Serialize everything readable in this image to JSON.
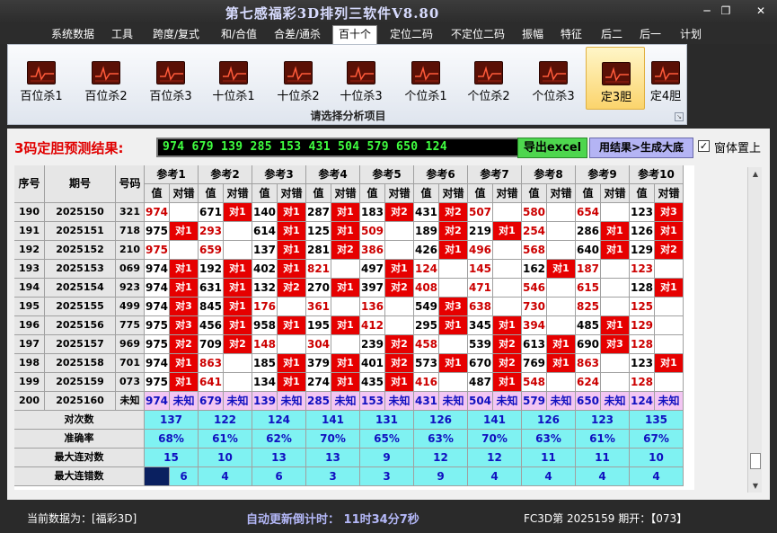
{
  "window": {
    "title": "第七感福彩3D排列三软件V8.80",
    "minimize_glyph": "─",
    "restore_glyph": "❐",
    "close_glyph": "✕"
  },
  "menu": {
    "items": [
      "系统数据",
      "工具",
      "跨度/复式",
      "和/合值",
      "合差/通杀",
      "百十个",
      "定位二码",
      "不定位二码",
      "振幅",
      "特征",
      "后二",
      "后一",
      "计划"
    ],
    "active": "百十个"
  },
  "ribbon": {
    "buttons": [
      {
        "label": "百位杀1",
        "icon": "chart-icon"
      },
      {
        "label": "百位杀2",
        "icon": "chart-icon"
      },
      {
        "label": "百位杀3",
        "icon": "chart-icon"
      },
      {
        "label": "十位杀1",
        "icon": "chart-icon"
      },
      {
        "label": "十位杀2",
        "icon": "chart-icon"
      },
      {
        "label": "十位杀3",
        "icon": "chart-icon"
      },
      {
        "label": "个位杀1",
        "icon": "chart-icon"
      },
      {
        "label": "个位杀2",
        "icon": "chart-icon"
      },
      {
        "label": "个位杀3",
        "icon": "chart-icon"
      },
      {
        "label": "定3胆",
        "icon": "chart-icon"
      },
      {
        "label": "定4胆",
        "icon": "chart-icon"
      }
    ],
    "active": "定3胆",
    "group_label": "请选择分析项目",
    "launcher_glyph": "↘"
  },
  "result": {
    "label": "3码定胆预测结果:",
    "value": "974 679 139 285 153 431 504 579 650 124",
    "export_button": "导出excel",
    "bigbase_button": "用结果>生成大底",
    "stay_on_top_label": "窗体置上",
    "stay_on_top_checked": true
  },
  "table": {
    "headers": {
      "seq": "序号",
      "period": "期号",
      "number": "号码",
      "value": "值",
      "result": "对错"
    },
    "ref_headers": [
      "参考1",
      "参考2",
      "参考3",
      "参考4",
      "参考5",
      "参考6",
      "参考7",
      "参考8",
      "参考9",
      "参考10"
    ],
    "rows": [
      {
        "seq": "190",
        "period": "2025150",
        "number": "321",
        "cells": [
          [
            "974",
            ""
          ],
          [
            "671",
            "对1"
          ],
          [
            "140",
            "对1"
          ],
          [
            "287",
            "对1"
          ],
          [
            "183",
            "对2"
          ],
          [
            "431",
            "对2"
          ],
          [
            "507",
            ""
          ],
          [
            "580",
            ""
          ],
          [
            "654",
            ""
          ],
          [
            "123",
            "对3"
          ]
        ]
      },
      {
        "seq": "191",
        "period": "2025151",
        "number": "718",
        "cells": [
          [
            "975",
            "对1"
          ],
          [
            "293",
            ""
          ],
          [
            "614",
            "对1"
          ],
          [
            "125",
            "对1"
          ],
          [
            "509",
            ""
          ],
          [
            "189",
            "对2"
          ],
          [
            "219",
            "对1"
          ],
          [
            "254",
            ""
          ],
          [
            "286",
            "对1"
          ],
          [
            "126",
            "对1"
          ]
        ]
      },
      {
        "seq": "192",
        "period": "2025152",
        "number": "210",
        "cells": [
          [
            "975",
            ""
          ],
          [
            "659",
            ""
          ],
          [
            "137",
            "对1"
          ],
          [
            "281",
            "对2"
          ],
          [
            "386",
            ""
          ],
          [
            "426",
            "对1"
          ],
          [
            "496",
            ""
          ],
          [
            "568",
            ""
          ],
          [
            "640",
            "对1"
          ],
          [
            "129",
            "对2"
          ]
        ]
      },
      {
        "seq": "193",
        "period": "2025153",
        "number": "069",
        "cells": [
          [
            "974",
            "对1"
          ],
          [
            "192",
            "对1"
          ],
          [
            "402",
            "对1"
          ],
          [
            "821",
            ""
          ],
          [
            "497",
            "对1"
          ],
          [
            "124",
            ""
          ],
          [
            "145",
            ""
          ],
          [
            "162",
            "对1"
          ],
          [
            "187",
            ""
          ],
          [
            "123",
            ""
          ]
        ]
      },
      {
        "seq": "194",
        "period": "2025154",
        "number": "923",
        "cells": [
          [
            "974",
            "对1"
          ],
          [
            "631",
            "对1"
          ],
          [
            "132",
            "对2"
          ],
          [
            "270",
            "对1"
          ],
          [
            "397",
            "对2"
          ],
          [
            "408",
            ""
          ],
          [
            "471",
            ""
          ],
          [
            "546",
            ""
          ],
          [
            "615",
            ""
          ],
          [
            "128",
            "对1"
          ]
        ]
      },
      {
        "seq": "195",
        "period": "2025155",
        "number": "499",
        "cells": [
          [
            "974",
            "对3"
          ],
          [
            "845",
            "对1"
          ],
          [
            "176",
            ""
          ],
          [
            "361",
            ""
          ],
          [
            "136",
            ""
          ],
          [
            "549",
            "对3"
          ],
          [
            "638",
            ""
          ],
          [
            "730",
            ""
          ],
          [
            "825",
            ""
          ],
          [
            "125",
            ""
          ]
        ]
      },
      {
        "seq": "196",
        "period": "2025156",
        "number": "775",
        "cells": [
          [
            "975",
            "对3"
          ],
          [
            "456",
            "对1"
          ],
          [
            "958",
            "对1"
          ],
          [
            "195",
            "对1"
          ],
          [
            "412",
            ""
          ],
          [
            "295",
            "对1"
          ],
          [
            "345",
            "对1"
          ],
          [
            "394",
            ""
          ],
          [
            "485",
            "对1"
          ],
          [
            "129",
            ""
          ]
        ]
      },
      {
        "seq": "197",
        "period": "2025157",
        "number": "969",
        "cells": [
          [
            "975",
            "对2"
          ],
          [
            "709",
            "对2"
          ],
          [
            "148",
            ""
          ],
          [
            "304",
            ""
          ],
          [
            "239",
            "对2"
          ],
          [
            "458",
            ""
          ],
          [
            "539",
            "对2"
          ],
          [
            "613",
            "对1"
          ],
          [
            "690",
            "对3"
          ],
          [
            "128",
            ""
          ]
        ]
      },
      {
        "seq": "198",
        "period": "2025158",
        "number": "701",
        "cells": [
          [
            "974",
            "对1"
          ],
          [
            "863",
            ""
          ],
          [
            "185",
            "对1"
          ],
          [
            "379",
            "对1"
          ],
          [
            "401",
            "对2"
          ],
          [
            "573",
            "对1"
          ],
          [
            "670",
            "对2"
          ],
          [
            "769",
            "对1"
          ],
          [
            "863",
            ""
          ],
          [
            "123",
            "对1"
          ]
        ]
      },
      {
        "seq": "199",
        "period": "2025159",
        "number": "073",
        "cells": [
          [
            "975",
            "对1"
          ],
          [
            "641",
            ""
          ],
          [
            "134",
            "对1"
          ],
          [
            "274",
            "对1"
          ],
          [
            "435",
            "对1"
          ],
          [
            "416",
            ""
          ],
          [
            "487",
            "对1"
          ],
          [
            "548",
            ""
          ],
          [
            "624",
            ""
          ],
          [
            "128",
            ""
          ]
        ]
      }
    ],
    "prediction_row": {
      "seq": "200",
      "period": "2025160",
      "number": "未知",
      "values": [
        "974",
        "679",
        "139",
        "285",
        "153",
        "431",
        "504",
        "579",
        "650",
        "124"
      ],
      "result": "未知"
    },
    "stats": [
      {
        "label": "对次数",
        "values": [
          "137",
          "122",
          "124",
          "141",
          "131",
          "126",
          "141",
          "126",
          "123",
          "135"
        ]
      },
      {
        "label": "准确率",
        "values": [
          "68%",
          "61%",
          "62%",
          "70%",
          "65%",
          "63%",
          "70%",
          "63%",
          "61%",
          "67%"
        ]
      },
      {
        "label": "最大连对数",
        "values": [
          "15",
          "10",
          "13",
          "13",
          "9",
          "12",
          "12",
          "11",
          "11",
          "10"
        ]
      },
      {
        "label": "最大连错数",
        "values": [
          "6",
          "4",
          "6",
          "3",
          "3",
          "9",
          "4",
          "4",
          "4",
          "4"
        ]
      }
    ]
  },
  "scrollbar": {
    "up_glyph": "▲",
    "down_glyph": "▼"
  },
  "status": {
    "current_data": "当前数据为：[福彩3D]",
    "countdown": "自动更新倒计时：  11时34分7秒",
    "period_info": "FC3D第 2025159 期开：【073】"
  },
  "colors": {
    "hit": "#e60000",
    "miss_value": "#cc0000",
    "prediction_row": "#f3c6f3",
    "stats_row": "#7ff2f2",
    "result_text": "#40ff40",
    "title": "#d8dcff"
  }
}
